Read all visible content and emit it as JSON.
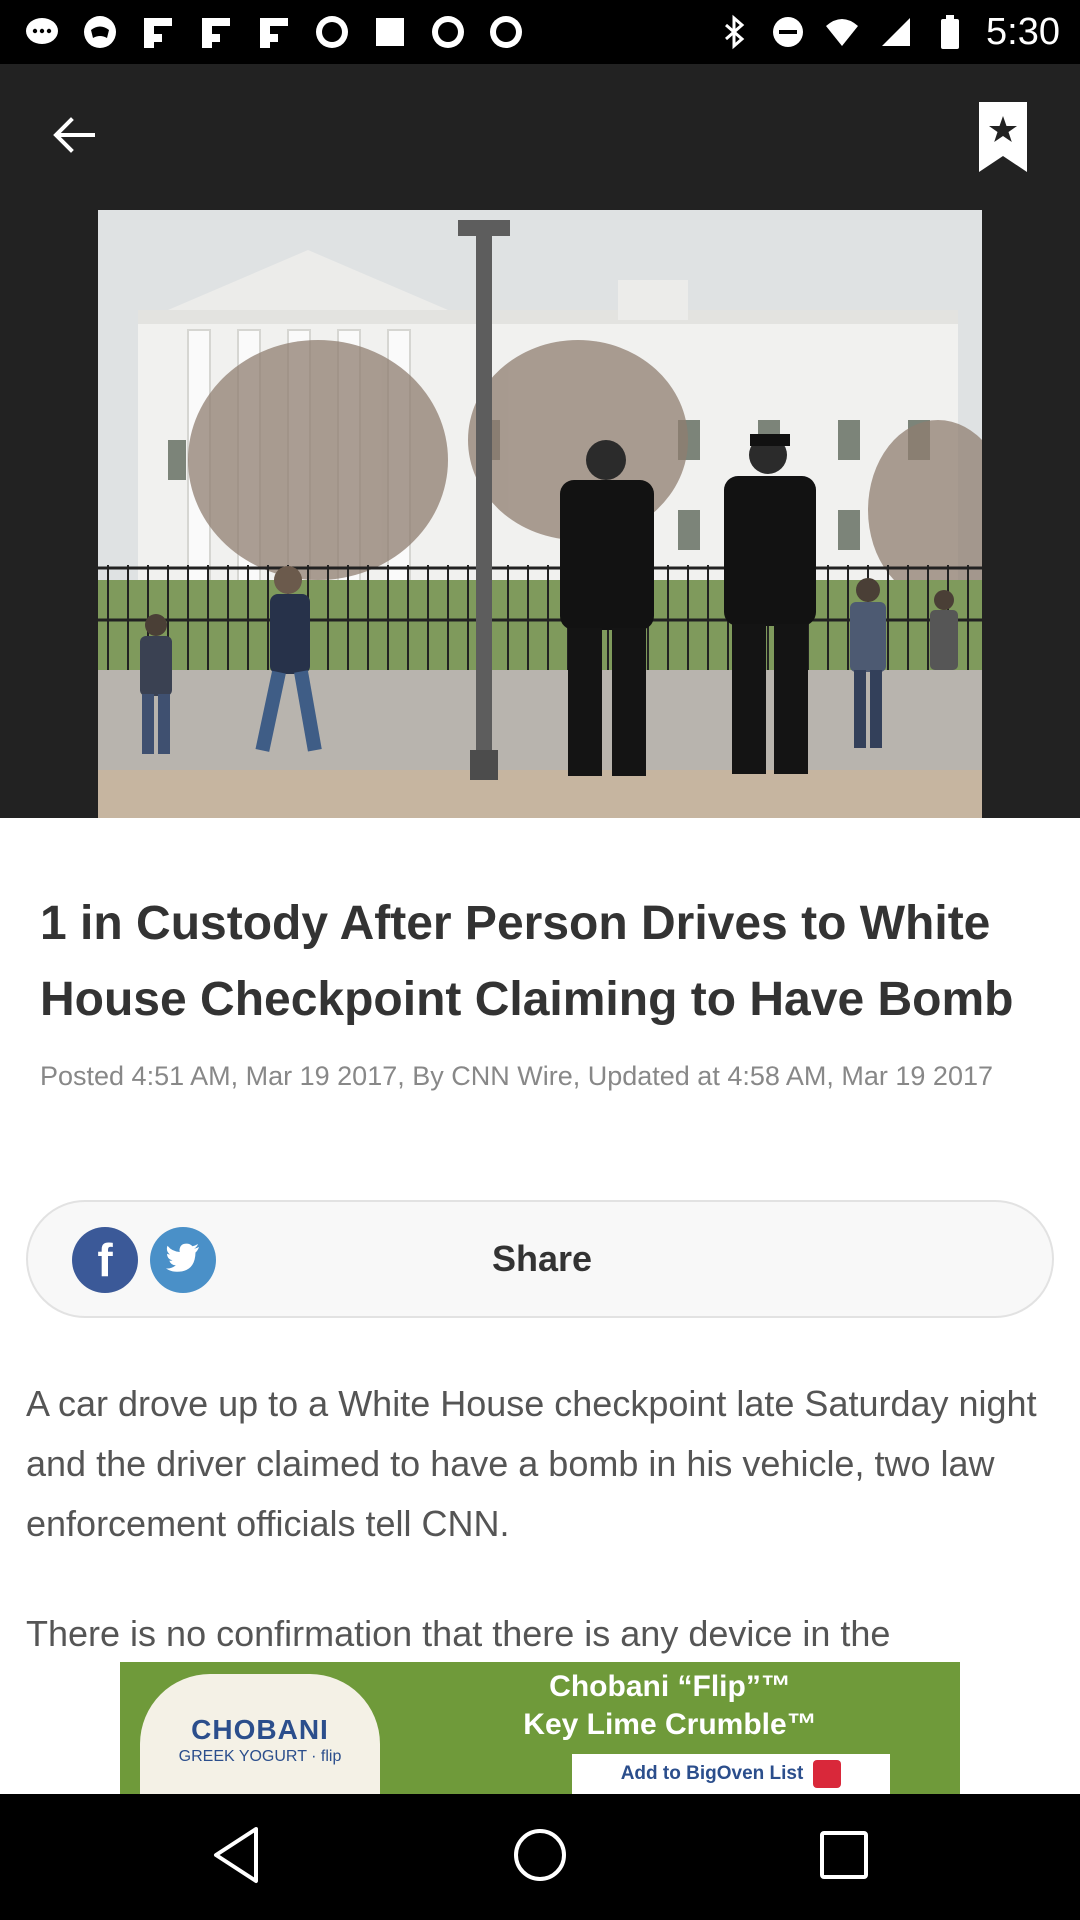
{
  "status_bar": {
    "time": "5:30",
    "left_icons": [
      "messages-icon",
      "game-controller-icon",
      "flipboard-icon",
      "flipboard-icon",
      "flipboard-icon",
      "abc13-icon",
      "square-icon",
      "abc13-icon",
      "abc13-icon"
    ],
    "right_icons": [
      "bluetooth-icon",
      "do-not-disturb-icon",
      "wifi-icon",
      "cellular-signal-icon",
      "battery-icon"
    ]
  },
  "header": {
    "back_icon": "arrow-left-icon",
    "bookmark_icon": "bookmark-star-icon"
  },
  "article": {
    "headline": "1 in Custody After Person Drives to White House Checkpoint Claiming to Have Bomb",
    "meta": "Posted 4:51 AM, Mar 19 2017, By CNN Wire, Updated at 4:58 AM, Mar 19 2017",
    "share": {
      "label": "Share",
      "facebook_glyph": "f"
    },
    "paragraphs": [
      "A car drove up to a White House checkpoint late Saturday night and the driver claimed to have a bomb in his vehicle, two law enforcement officials tell CNN.",
      "There is no confirmation that there is any device in the"
    ]
  },
  "ad": {
    "brand": "CHOBANI",
    "brand_sub": "GREEK YOGURT · flip",
    "line1": "Chobani “Flip”™",
    "line2": "Key Lime Crumble™",
    "cta": "Add to BigOven List"
  },
  "colors": {
    "hero_bg": "#222222",
    "facebook": "#3b5998",
    "twitter": "#4a90c8",
    "ad_green": "#6f9a3a"
  }
}
